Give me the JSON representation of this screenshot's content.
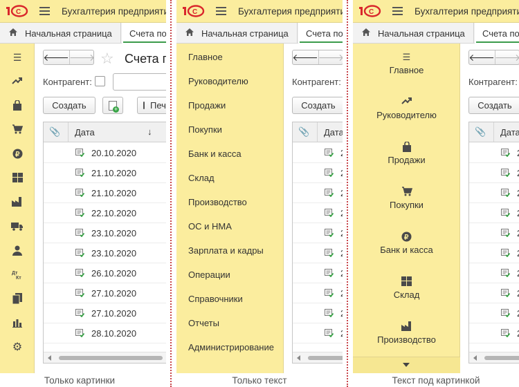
{
  "app": {
    "title": "Бухгалтерия предприятия"
  },
  "tabs": {
    "home": "Начальная страница",
    "doc": "Счета покупателям"
  },
  "form": {
    "title": "Счета покупателям",
    "counterparty_label": "Контрагент:",
    "create_label": "Создать",
    "print_label": "Печать"
  },
  "table": {
    "date_header": "Дата",
    "rows": [
      "20.10.2020",
      "21.10.2020",
      "21.10.2020",
      "22.10.2020",
      "23.10.2020",
      "23.10.2020",
      "26.10.2020",
      "27.10.2020",
      "27.10.2020",
      "28.10.2020"
    ]
  },
  "sections": [
    "Главное",
    "Руководителю",
    "Продажи",
    "Покупки",
    "Банк и касса",
    "Склад",
    "Производство",
    "ОС и НМА",
    "Зарплата и кадры",
    "Операции",
    "Справочники",
    "Отчеты",
    "Администрирование"
  ],
  "captions": {
    "icons_only": "Только картинки",
    "text_only": "Только текст",
    "text_under": "Текст под картинкой"
  },
  "colors": {
    "section_panel": "#fbed9e",
    "brand_red": "#d9262c",
    "active_tab": "#3a9a4a",
    "posted_check": "#3aa548"
  }
}
